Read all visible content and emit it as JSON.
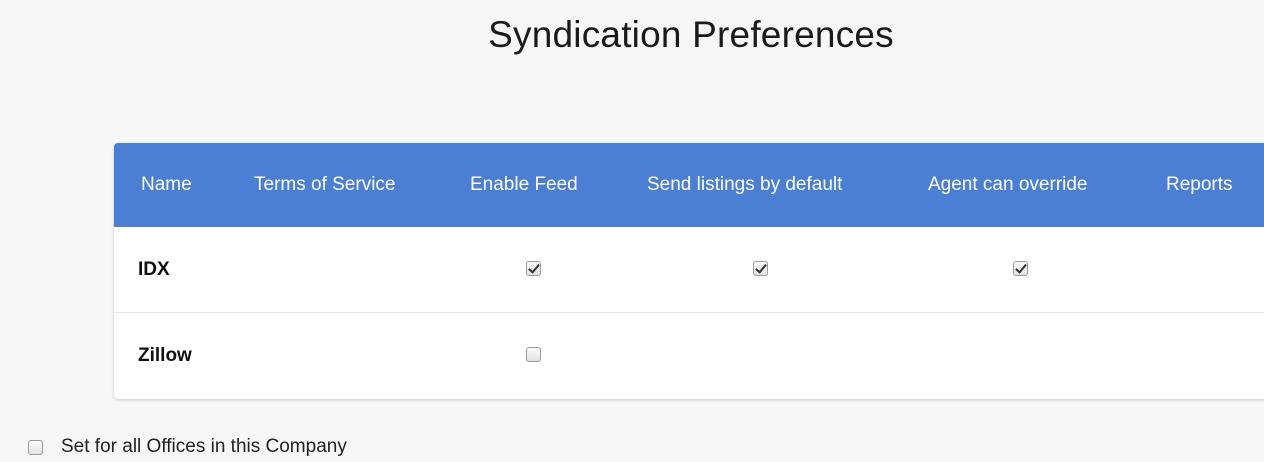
{
  "page": {
    "title": "Syndication Preferences"
  },
  "table": {
    "headers": {
      "name": "Name",
      "terms_of_service": "Terms of Service",
      "enable_feed": "Enable Feed",
      "send_by_default": "Send listings by default",
      "agent_override": "Agent can override",
      "reports": "Reports"
    },
    "rows": [
      {
        "name": "IDX",
        "enable_feed": true,
        "send_by_default": true,
        "agent_override": true
      },
      {
        "name": "Zillow",
        "enable_feed": false
      }
    ]
  },
  "footer": {
    "set_all_label": "Set for all Offices in this Company",
    "set_all_checked": false
  },
  "colors": {
    "header_bg": "#4a7fd4",
    "header_text": "#ffffff",
    "page_bg": "#f7f7f7"
  }
}
